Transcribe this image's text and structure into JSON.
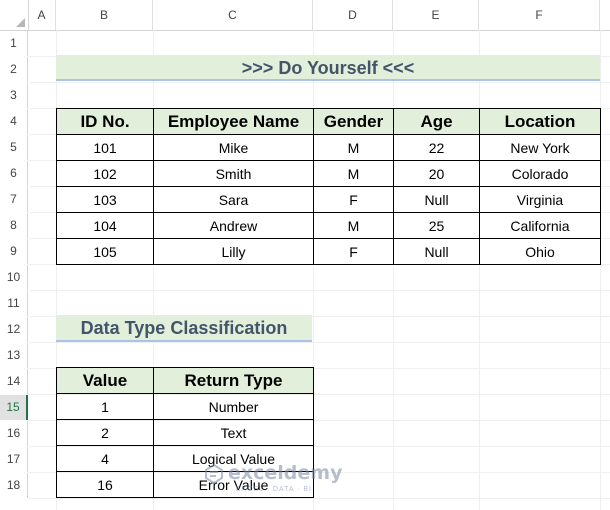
{
  "columns": [
    "A",
    "B",
    "C",
    "D",
    "E",
    "F"
  ],
  "rows": [
    "1",
    "2",
    "3",
    "4",
    "5",
    "6",
    "7",
    "8",
    "9",
    "10",
    "11",
    "12",
    "13",
    "14",
    "15",
    "16",
    "17",
    "18"
  ],
  "selected_row": "15",
  "banner_title": ">>> Do Yourself <<<",
  "employee_table": {
    "headers": [
      "ID No.",
      "Employee Name",
      "Gender",
      "Age",
      "Location"
    ],
    "rows": [
      [
        "101",
        "Mike",
        "M",
        "22",
        "New York"
      ],
      [
        "102",
        "Smith",
        "M",
        "20",
        "Colorado"
      ],
      [
        "103",
        "Sara",
        "F",
        "Null",
        "Virginia"
      ],
      [
        "104",
        "Andrew",
        "M",
        "25",
        "California"
      ],
      [
        "105",
        "Lilly",
        "F",
        "Null",
        "Ohio"
      ]
    ]
  },
  "classification": {
    "title": "Data Type Classification",
    "headers": [
      "Value",
      "Return Type"
    ],
    "rows": [
      [
        "1",
        "Number"
      ],
      [
        "2",
        "Text"
      ],
      [
        "4",
        "Logical Value"
      ],
      [
        "16",
        "Error Value"
      ]
    ]
  },
  "watermark": {
    "name": "exceldemy",
    "tagline": "EXCEL · DATA · BI"
  },
  "colors": {
    "header_fill": "#e2efda",
    "title_text": "#44546a",
    "accent_line": "#a9c4e4",
    "excel_green": "#217346"
  }
}
